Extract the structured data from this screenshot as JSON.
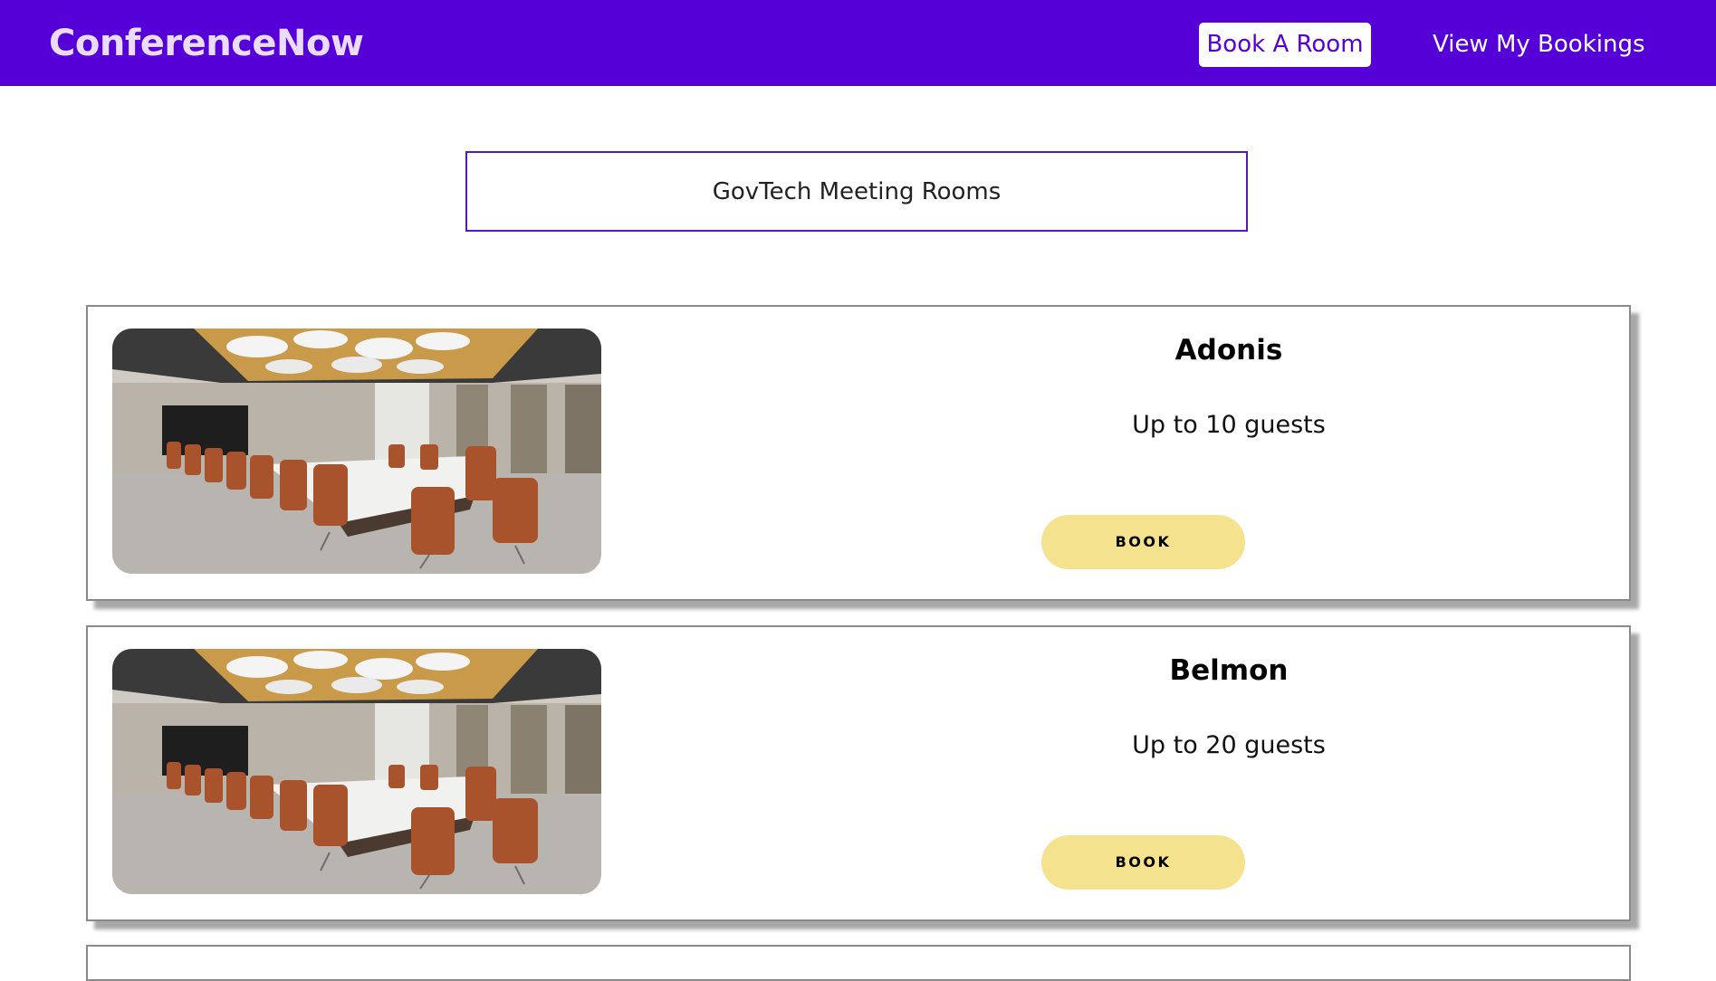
{
  "header": {
    "brand": "ConferenceNow",
    "nav": {
      "book_room": "Book A Room",
      "view_bookings": "View My Bookings"
    }
  },
  "search": {
    "title": "GovTech Meeting Rooms"
  },
  "rooms": [
    {
      "name": "Adonis",
      "capacity": "Up to 10 guests",
      "button": "BOOK"
    },
    {
      "name": "Belmon",
      "capacity": "Up to 20 guests",
      "button": "BOOK"
    }
  ],
  "colors": {
    "navbar": "#5500d6",
    "brand_text": "#eadcff",
    "book_button": "#f5e28e",
    "search_border": "#5a1ab0"
  },
  "icons": {
    "room_photo": "conference-room-photo"
  }
}
